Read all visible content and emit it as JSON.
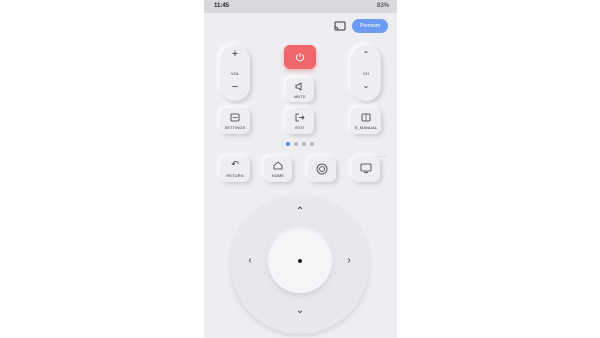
{
  "status": {
    "time": "11:45",
    "right": "83%"
  },
  "header": {
    "premium_label": "Premium"
  },
  "controls": {
    "vol_label": "VOL",
    "ch_label": "CH",
    "mute_label": "MUTE",
    "settings_label": "SETTINGS",
    "exit_label": "EXIT",
    "emanual_label": "E_MANUAL",
    "return_label": "RETURN",
    "home_label": "HOME"
  },
  "pager": {
    "count": 4,
    "active": 0
  },
  "colors": {
    "accent": "#4c8cf5",
    "power": "#f0666b",
    "background": "#eeeef2"
  },
  "icons": [
    "cast-icon",
    "power-icon",
    "plus-icon",
    "minus-icon",
    "chevron-up-icon",
    "chevron-down-icon",
    "speaker-icon",
    "settings-icon",
    "exit-icon",
    "manual-icon",
    "return-icon",
    "home-icon",
    "source-icon",
    "input-icon",
    "arrow-up-icon",
    "arrow-down-icon",
    "arrow-left-icon",
    "arrow-right-icon"
  ]
}
